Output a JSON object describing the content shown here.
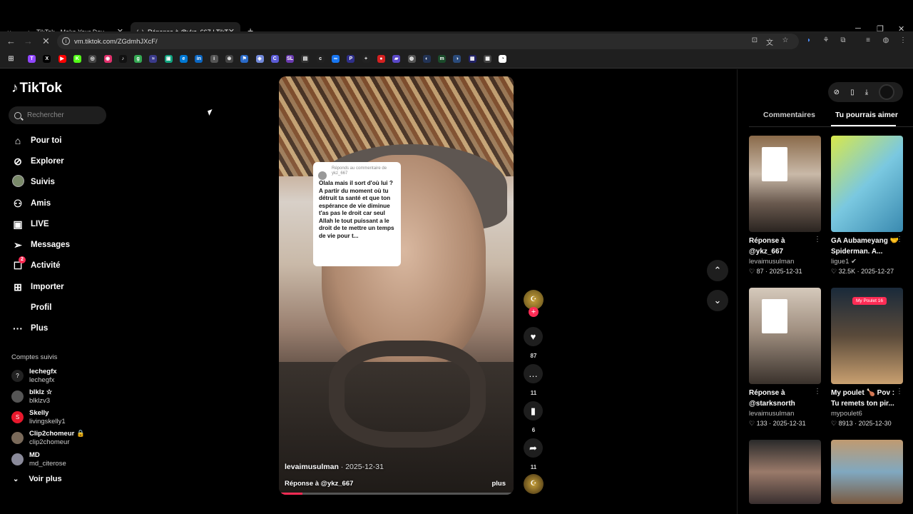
{
  "browser": {
    "tabs": [
      {
        "title": "TikTok - Make Your Day",
        "active": false
      },
      {
        "title": "Réponse à @ykz_667 | TikTok",
        "active": true
      }
    ],
    "url": "vm.tiktok.com/ZGdmhJXcF/"
  },
  "bookmarks": [
    {
      "label": "T",
      "color": "#9146ff"
    },
    {
      "label": "X",
      "color": "#000000"
    },
    {
      "label": "▶",
      "color": "#ff0000"
    },
    {
      "label": "K",
      "color": "#53fc18"
    },
    {
      "label": "◎",
      "color": "#444444"
    },
    {
      "label": "◉",
      "color": "#e1306c"
    },
    {
      "label": "♪",
      "color": "#111111"
    },
    {
      "label": "g",
      "color": "#34a853"
    },
    {
      "label": "≈",
      "color": "#3a3a8a"
    },
    {
      "label": "▣",
      "color": "#10a37f"
    },
    {
      "label": "e",
      "color": "#0078d4"
    },
    {
      "label": "in",
      "color": "#0a66c2"
    },
    {
      "label": "i",
      "color": "#555555"
    },
    {
      "label": "⊛",
      "color": "#444444"
    },
    {
      "label": "⚑",
      "color": "#2a6ac8"
    },
    {
      "label": "◈",
      "color": "#7289da"
    },
    {
      "label": "C",
      "color": "#5b5bd6"
    },
    {
      "label": "SL",
      "color": "#6a3ab0"
    },
    {
      "label": "▤",
      "color": "#333333"
    },
    {
      "label": "c",
      "color": "#222222"
    },
    {
      "label": "∞",
      "color": "#1877f2"
    },
    {
      "label": "P",
      "color": "#2f2f8a"
    },
    {
      "label": "+",
      "color": "#222222"
    },
    {
      "label": "●",
      "color": "#d42020"
    },
    {
      "label": "▰",
      "color": "#5a48c8"
    },
    {
      "label": "◍",
      "color": "#555555"
    },
    {
      "label": "◐",
      "color": "#223355"
    },
    {
      "label": "m",
      "color": "#1a4a2a"
    },
    {
      "label": "◑",
      "color": "#2a4a7a"
    },
    {
      "label": "▦",
      "color": "#222266"
    },
    {
      "label": "▩",
      "color": "#444444"
    },
    {
      "label": "◔",
      "color": "#ffffff"
    }
  ],
  "tiktok": {
    "logo": "TikTok",
    "search_placeholder": "Rechercher",
    "nav": [
      {
        "label": "Pour toi",
        "icon": "home-icon"
      },
      {
        "label": "Explorer",
        "icon": "compass-icon"
      },
      {
        "label": "Suivis",
        "icon": "following-avatar-icon"
      },
      {
        "label": "Amis",
        "icon": "friends-icon"
      },
      {
        "label": "LIVE",
        "icon": "live-icon"
      },
      {
        "label": "Messages",
        "icon": "paper-plane-icon"
      },
      {
        "label": "Activité",
        "icon": "activity-icon",
        "badge": "2"
      },
      {
        "label": "Importer",
        "icon": "plus-square-icon"
      },
      {
        "label": "Profil",
        "icon": ""
      },
      {
        "label": "Plus",
        "icon": "more-dots-icon"
      }
    ],
    "followed_heading": "Comptes suivis",
    "followed": [
      {
        "name": "lechegfx",
        "handle": "lechegfx",
        "avatar_color": "#222222",
        "avatar_glyph": "?"
      },
      {
        "name": "blklz ☆",
        "handle": "blklzv3",
        "avatar_color": "#555555",
        "avatar_glyph": ""
      },
      {
        "name": "Skelly",
        "handle": "livingskelly1",
        "avatar_color": "#e8182c",
        "avatar_glyph": "S"
      },
      {
        "name": "Clip2chomeur 🔒",
        "handle": "clip2chomeur",
        "avatar_color": "#7a6a5a",
        "avatar_glyph": ""
      },
      {
        "name": "MD",
        "handle": "md_citerose",
        "avatar_color": "#8a8a9a",
        "avatar_glyph": ""
      }
    ],
    "see_more": "Voir plus",
    "video": {
      "overlay_reply_to": "Réponds au commentaire de ykz_667",
      "overlay_text": "Olala mais il sort d'où lui ? A partir du moment où tu détruit ta santé et que ton espérance de vie diminue t'as pas le droit car seul Allah le tout puissant a le droit de te mettre un temps de vie pour t...",
      "author": "levaimusulman",
      "date": "· 2025-12-31",
      "caption": "Réponse à @ykz_667",
      "more": "plus",
      "progress": 0.1
    },
    "actions": {
      "likes": "87",
      "comments": "11",
      "saves": "6",
      "shares": "11"
    },
    "right_panel": {
      "tabs": [
        "Commentaires",
        "Tu pourrais aimer"
      ],
      "active_tab": "Tu pourrais aimer",
      "cards": [
        {
          "title": "Réponse à @ykz_667",
          "author": "levaimusulman",
          "likes": "87",
          "date": "2025-12-31"
        },
        {
          "title": "GA Aubameyang 🤝 Spiderman. A...",
          "author": "ligue1 ✔",
          "likes": "32.5K",
          "date": "2025-12-27"
        },
        {
          "title": "Réponse à @starksnorth",
          "author": "levaimusulman",
          "likes": "133",
          "date": "2025-12-31"
        },
        {
          "title": "My poulet 🍗 Pov : Tu remets ton pir...",
          "author": "mypoulet6",
          "likes": "8913",
          "date": "2025-12-30",
          "pill": "My Poulet 16"
        },
        {
          "title": "",
          "author": "",
          "likes": "",
          "date": ""
        },
        {
          "title": "",
          "author": "",
          "likes": "",
          "date": ""
        }
      ]
    }
  }
}
